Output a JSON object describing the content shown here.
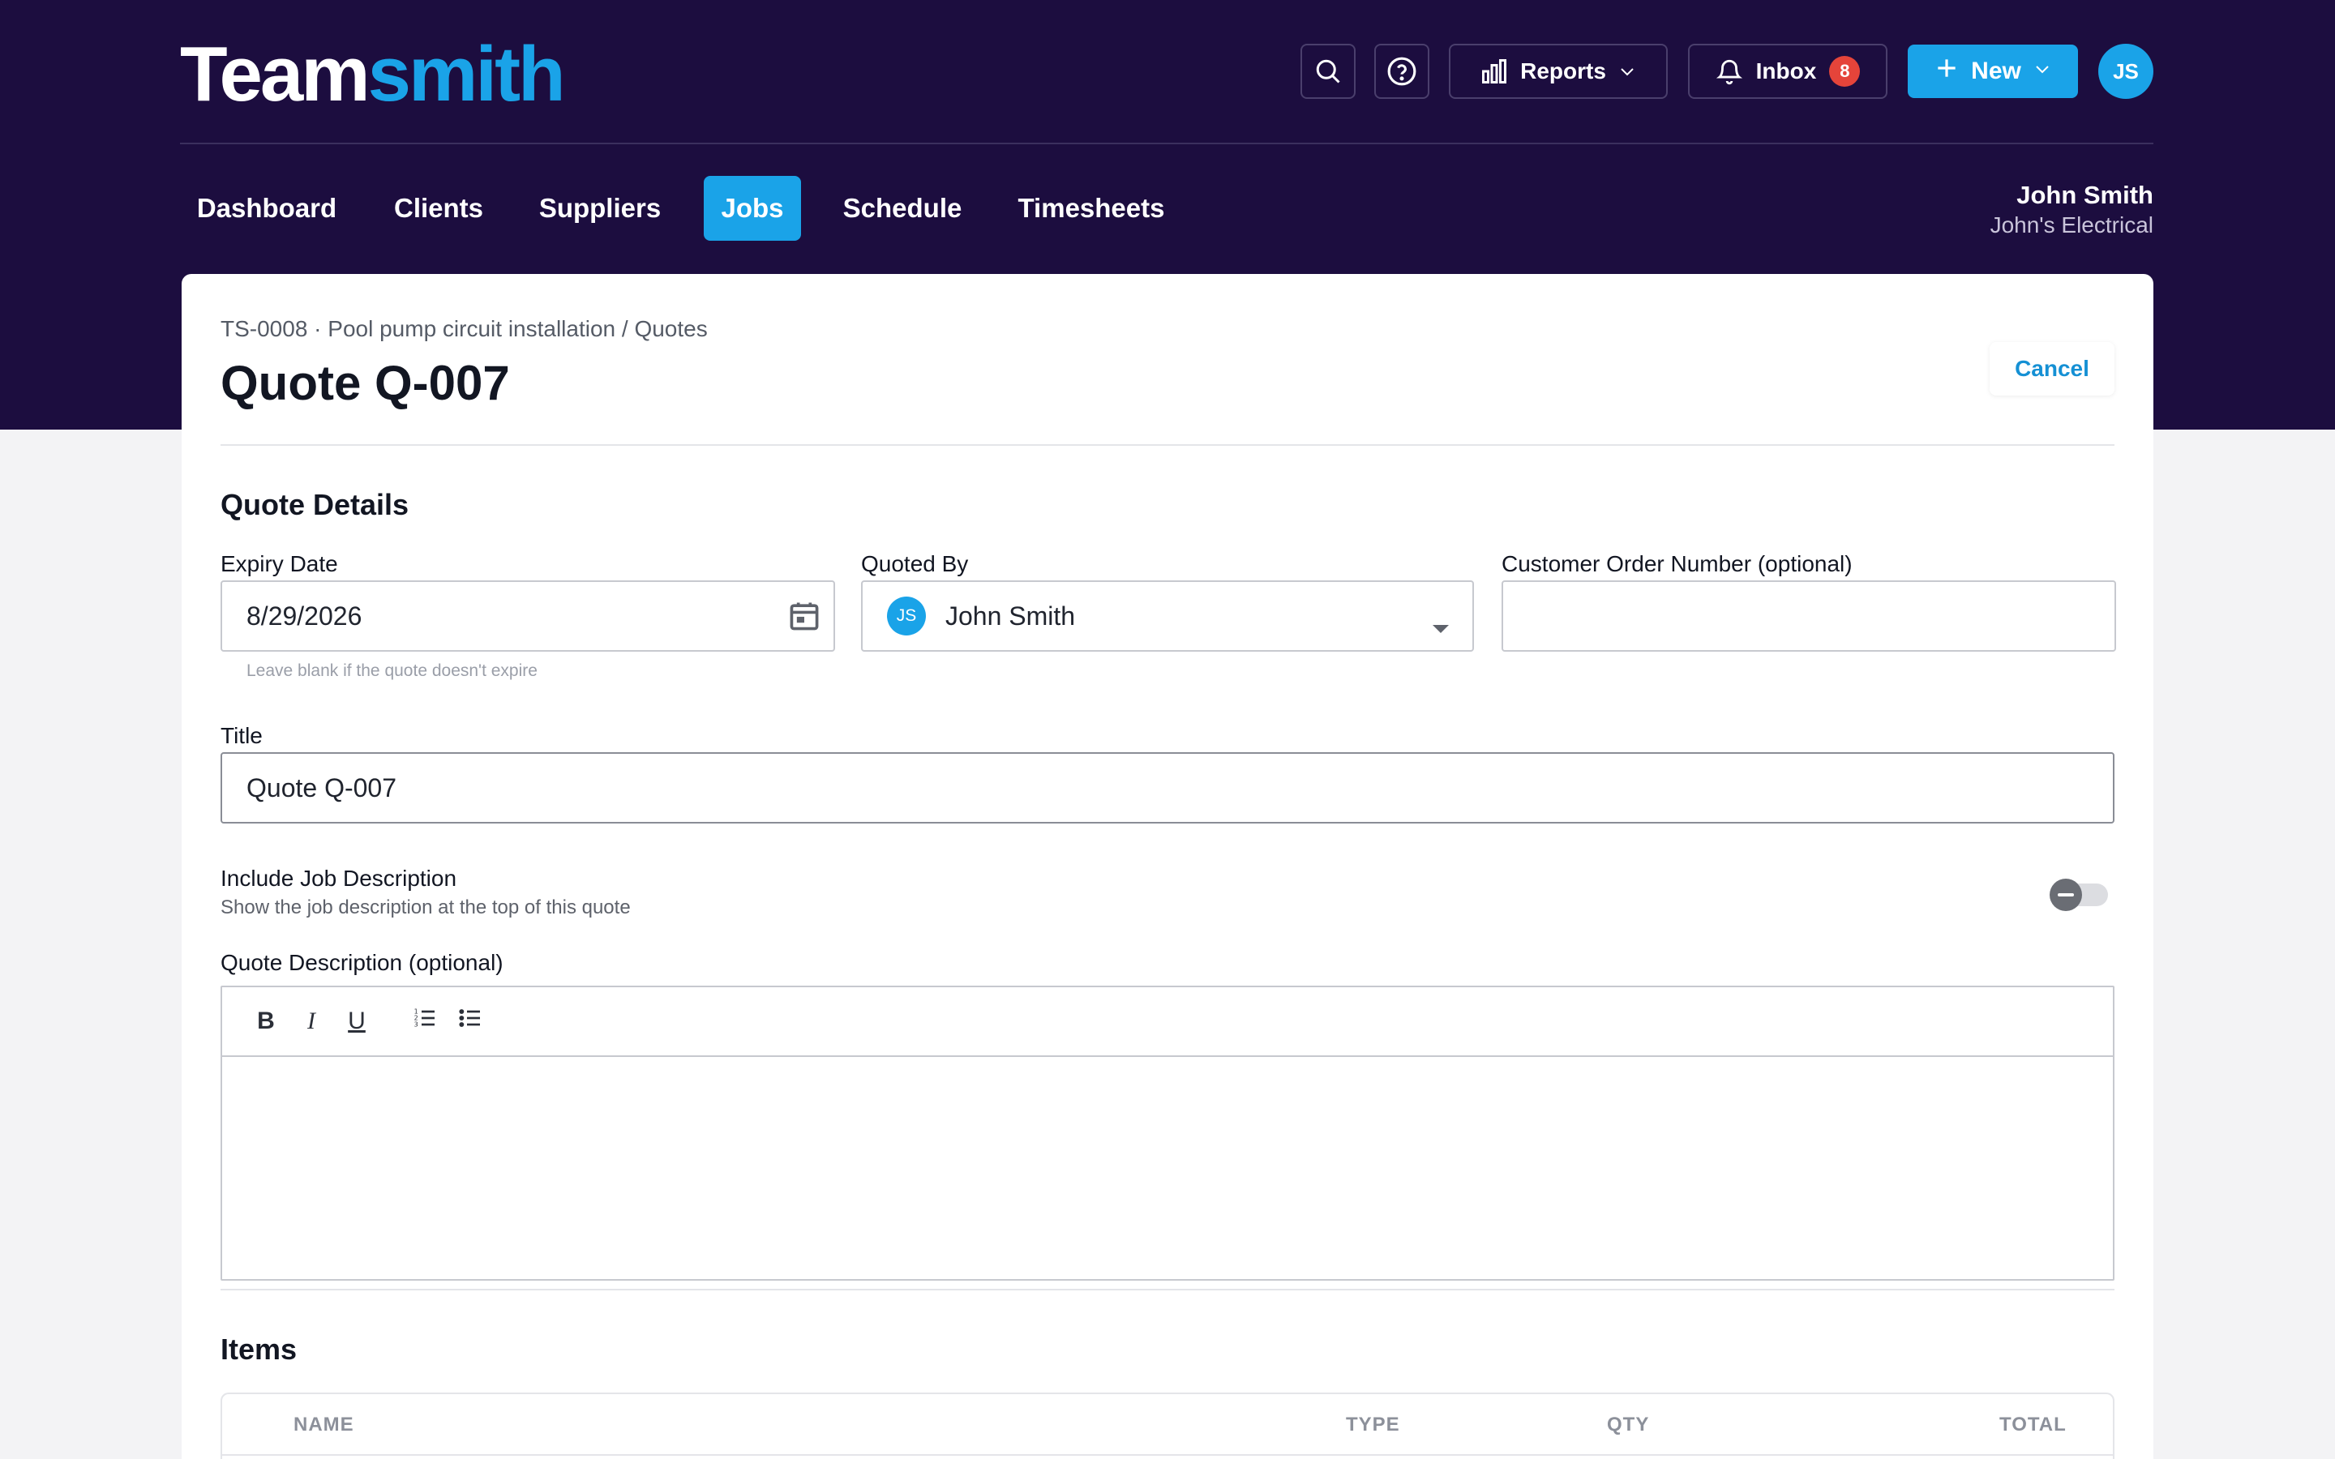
{
  "app": {
    "logo_part1": "Team",
    "logo_part2": "smith"
  },
  "header": {
    "reports_label": "Reports",
    "inbox_label": "Inbox",
    "inbox_count": "8",
    "new_label": "New",
    "avatar_initials": "JS"
  },
  "nav": {
    "items": [
      {
        "label": "Dashboard"
      },
      {
        "label": "Clients"
      },
      {
        "label": "Suppliers"
      },
      {
        "label": "Jobs"
      },
      {
        "label": "Schedule"
      },
      {
        "label": "Timesheets"
      }
    ],
    "active": "Jobs"
  },
  "user": {
    "name": "John Smith",
    "company": "John's Electrical"
  },
  "page": {
    "breadcrumb": "TS-0008 · Pool pump circuit installation / Quotes",
    "title": "Quote Q-007",
    "cancel_label": "Cancel"
  },
  "quote_details": {
    "section_title": "Quote Details",
    "expiry_label": "Expiry Date",
    "expiry_value": "8/29/2026",
    "expiry_hint": "Leave blank if the quote doesn't expire",
    "quoted_by_label": "Quoted By",
    "quoted_by_initials": "JS",
    "quoted_by_value": "John Smith",
    "order_number_label": "Customer Order Number (optional)",
    "order_number_value": "",
    "title_label": "Title",
    "title_value": "Quote Q-007",
    "include_desc_label": "Include Job Description",
    "include_desc_sub": "Show the job description at the top of this quote",
    "include_desc_enabled": false,
    "quote_desc_label": "Quote Description (optional)",
    "toolbar": {
      "bold": "B",
      "italic": "I",
      "underline": "U"
    }
  },
  "items": {
    "section_title": "Items",
    "columns": [
      "NAME",
      "TYPE",
      "QTY",
      "TOTAL"
    ]
  },
  "colors": {
    "brand_dark": "#1c0d3f",
    "accent": "#1aa3e8",
    "badge": "#e5443a"
  }
}
